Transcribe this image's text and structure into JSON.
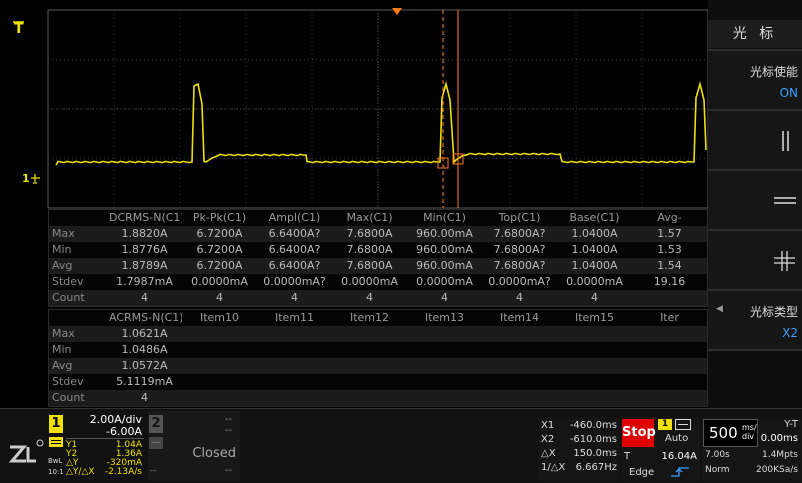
{
  "colors": {
    "ch1": "#f0e000",
    "cursor": "#ff7a1a",
    "accent": "#3aa0ff",
    "stop": "#e00000"
  },
  "screen": {
    "trigger_marker": "T",
    "ch1_marker": "1",
    "cursor_a_icon": "cursor-a-box-icon",
    "cursor_b_icon": "cursor-b-box-icon"
  },
  "measurements_top": {
    "headers": [
      "DCRMS-N(C1)",
      "Pk-Pk(C1)",
      "Ampl(C1)",
      "Max(C1)",
      "Min(C1)",
      "Top(C1)",
      "Base(C1)",
      "Avg-"
    ],
    "rows": [
      {
        "label": "Max",
        "values": [
          "1.8820A",
          "6.7200A",
          "6.6400A?",
          "7.6800A",
          "960.00mA",
          "7.6800A?",
          "1.0400A",
          "1.57"
        ]
      },
      {
        "label": "Min",
        "values": [
          "1.8776A",
          "6.7200A",
          "6.6400A?",
          "7.6800A",
          "960.00mA",
          "7.6800A?",
          "1.0400A",
          "1.53"
        ]
      },
      {
        "label": "Avg",
        "values": [
          "1.8789A",
          "6.7200A",
          "6.6400A?",
          "7.6800A",
          "960.00mA",
          "7.6800A?",
          "1.0400A",
          "1.54"
        ]
      },
      {
        "label": "Stdev",
        "values": [
          "1.7987mA",
          "0.0000mA",
          "0.0000mA?",
          "0.0000mA",
          "0.0000mA",
          "0.0000mA?",
          "0.0000mA",
          "19.16"
        ]
      },
      {
        "label": "Count",
        "values": [
          "4",
          "4",
          "4",
          "4",
          "4",
          "4",
          "4",
          ""
        ]
      }
    ]
  },
  "measurements_bottom": {
    "headers": [
      "ACRMS-N(C1)",
      "Item10",
      "Item11",
      "Item12",
      "Item13",
      "Item14",
      "Item15",
      "Iter"
    ],
    "rows": [
      {
        "label": "Max",
        "values": [
          "1.0621A",
          "",
          "",
          "",
          "",
          "",
          "",
          ""
        ]
      },
      {
        "label": "Min",
        "values": [
          "1.0486A",
          "",
          "",
          "",
          "",
          "",
          "",
          ""
        ]
      },
      {
        "label": "Avg",
        "values": [
          "1.0572A",
          "",
          "",
          "",
          "",
          "",
          "",
          ""
        ]
      },
      {
        "label": "Stdev",
        "values": [
          "5.1119mA",
          "",
          "",
          "",
          "",
          "",
          "",
          ""
        ]
      },
      {
        "label": "Count",
        "values": [
          "4",
          "",
          "",
          "",
          "",
          "",
          "",
          ""
        ]
      }
    ]
  },
  "menu": {
    "title": "光 标",
    "cursor_enable_label": "光标使能",
    "cursor_enable_value": "ON",
    "cursor_type_label": "光标类型",
    "cursor_type_value": "X2",
    "cursor_type_arrow": "◀"
  },
  "ch1": {
    "number": "1",
    "scale": "2.00A/div",
    "offset": "-6.00A",
    "bw_label": "BwL",
    "probe_label": "10:1",
    "y1_label": "Y1",
    "y1_value": "1.04A",
    "y2_label": "Y2",
    "y2_value": "1.36A",
    "dy_label": "△Y",
    "dy_value": "-320mA",
    "dydx_label": "△Y/△X",
    "dydx_value": "-2.13A/s"
  },
  "ch2": {
    "number": "2",
    "minus": "—",
    "scale": "--",
    "offset": "--",
    "status": "Closed",
    "extra_left": "--",
    "extra_right": "--"
  },
  "cursor_readout": {
    "x1_label": "X1",
    "x1_value": "-460.0ms",
    "x2_label": "X2",
    "x2_value": "-610.0ms",
    "dx_label": "△X",
    "dx_value": "150.0ms",
    "inv_label": "1/△X",
    "inv_value": "6.667Hz"
  },
  "trigger": {
    "run_state": "Stop",
    "source": "1",
    "mode": "Auto",
    "level_label": "T",
    "level_value": "16.04A",
    "type": "Edge"
  },
  "timebase": {
    "value": "500",
    "unit_top": "ms/",
    "unit_bottom": "div",
    "display_mode": "Y-T",
    "delay": "0.00ms",
    "length": "7.00s",
    "memory": "1.4Mpts",
    "acq_mode": "Norm",
    "sample_rate": "200KSa/s"
  }
}
